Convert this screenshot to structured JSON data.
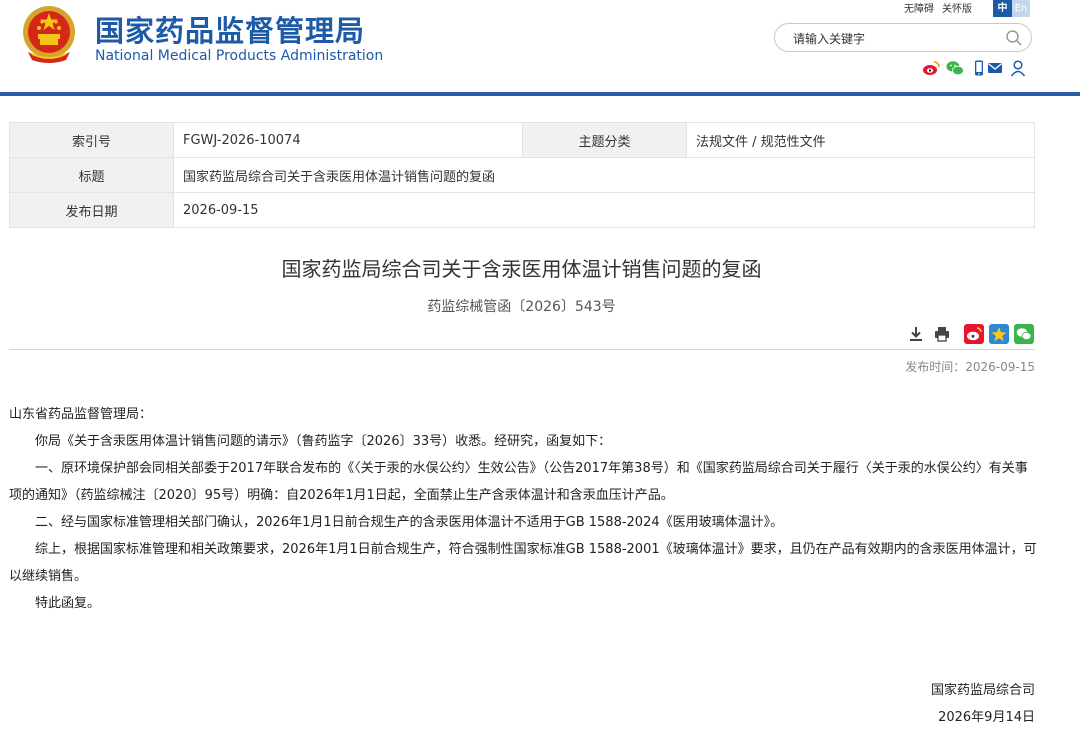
{
  "header": {
    "site_name_cn": "国家药品监督管理局",
    "site_name_en": "National Medical Products Administration",
    "top_links": {
      "accessibility": "无障碍",
      "elder": "关怀版",
      "lang_zh": "中",
      "lang_en": "En"
    },
    "search": {
      "placeholder": "请输入关键字"
    },
    "social_icons": [
      "weibo-icon",
      "wechat-icon",
      "mobile-icon",
      "mail-icon",
      "user-icon"
    ]
  },
  "info_table": {
    "index_label": "索引号",
    "index_value": "FGWJ-2026-10074",
    "category_label": "主题分类",
    "category_value": "法规文件 / 规范性文件",
    "title_label": "标题",
    "title_value": "国家药监局综合司关于含汞医用体温计销售问题的复函",
    "date_label": "发布日期",
    "date_value": "2026-09-15"
  },
  "article": {
    "title": "国家药监局综合司关于含汞医用体温计销售问题的复函",
    "doc_number": "药监综械管函〔2026〕543号",
    "tool_icons": [
      "download-icon",
      "print-icon",
      "weibo-share-icon",
      "qzone-share-icon",
      "wechat-share-icon"
    ],
    "publish_time": "发布时间：2026-09-15",
    "salutation": "山东省药品监督管理局：",
    "paragraphs": [
      "你局《关于含汞医用体温计销售问题的请示》（鲁药监字〔2026〕33号）收悉。经研究，函复如下：",
      "一、原环境保护部会同相关部委于2017年联合发布的《〈关于汞的水俣公约〉生效公告》（公告2017年第38号）和《国家药监局综合司关于履行〈关于汞的水俣公约〉有关事项的通知》（药监综械注〔2020〕95号）明确：自2026年1月1日起，全面禁止生产含汞体温计和含汞血压计产品。",
      "二、经与国家标准管理相关部门确认，2026年1月1日前合规生产的含汞医用体温计不适用于GB 1588-2024《医用玻璃体温计》。",
      "综上，根据国家标准管理和相关政策要求，2026年1月1日前合规生产，符合强制性国家标准GB 1588-2001《玻璃体温计》要求，且仍在产品有效期内的含汞医用体温计，可以继续销售。",
      "特此函复。"
    ],
    "signature_org": "国家药监局综合司",
    "signature_date": "2026年9月14日"
  },
  "colors": {
    "brand_blue": "#1d5aa8",
    "header_rule": "#2a5caa",
    "table_key_bg": "#f1f1f1"
  }
}
